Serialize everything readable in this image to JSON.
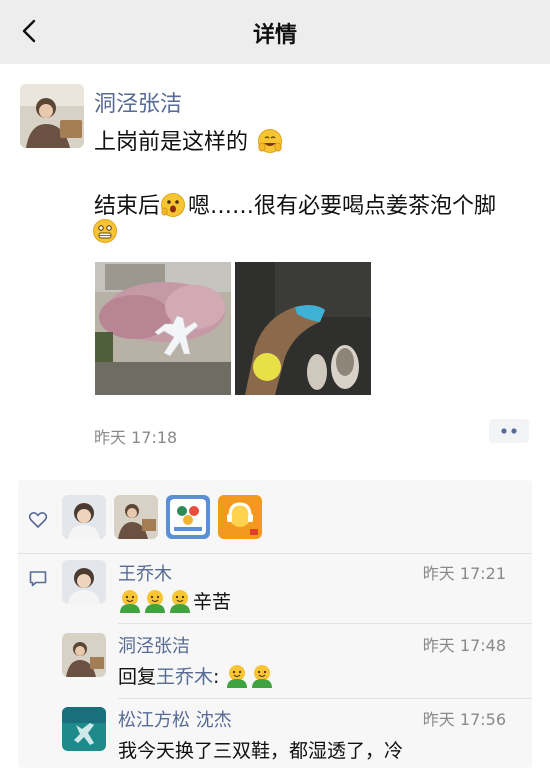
{
  "header": {
    "title": "详情"
  },
  "post": {
    "author": "洞泾张洁",
    "line1": "上岗前是这样的",
    "line2": "结束后",
    "line2b": "嗯……很有必要喝点姜茶泡个脚",
    "time": "昨天 17:18",
    "more": "••"
  },
  "comments": [
    {
      "name": "王乔木",
      "time": "昨天 17:21",
      "text": "辛苦"
    },
    {
      "name": "洞泾张洁",
      "time": "昨天 17:48",
      "reply_prefix": "回复",
      "reply_to": "王乔木",
      "reply_suffix": ":"
    },
    {
      "name": "松江方松 沈杰",
      "time": "昨天 17:56",
      "text": "我今天换了三双鞋，都湿透了，冷"
    }
  ],
  "colors": {
    "link": "#576b95",
    "nav_bg": "#ededed",
    "panel_bg": "#f7f7f7"
  }
}
